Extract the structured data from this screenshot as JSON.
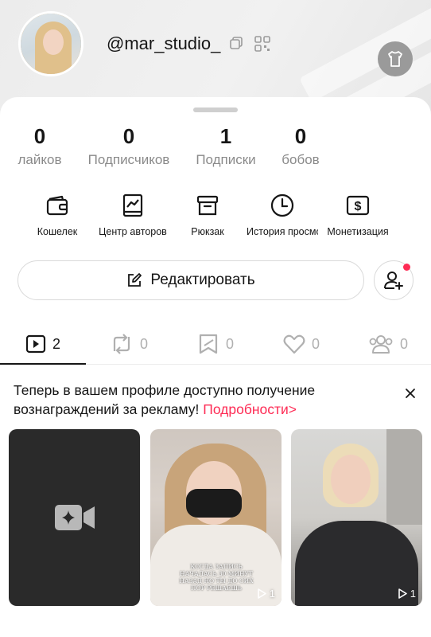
{
  "profile": {
    "username": "@mar_studio_"
  },
  "stats": [
    {
      "value": "0",
      "label": "лайков"
    },
    {
      "value": "0",
      "label": "Подписчиков"
    },
    {
      "value": "1",
      "label": "Подписки"
    },
    {
      "value": "0",
      "label": "бобов"
    }
  ],
  "tools": [
    {
      "label": "Кошелек",
      "icon": "wallet-icon"
    },
    {
      "label": "Центр авторов",
      "icon": "creator-center-icon"
    },
    {
      "label": "Рюкзак",
      "icon": "backpack-icon"
    },
    {
      "label": "История просмотров",
      "icon": "history-icon"
    },
    {
      "label": "Монетизация",
      "icon": "monetization-icon"
    }
  ],
  "edit_button": {
    "label": "Редактировать"
  },
  "tabs": [
    {
      "name": "videos",
      "count": "2",
      "icon": "video-icon"
    },
    {
      "name": "reposts",
      "count": "0",
      "icon": "repost-icon"
    },
    {
      "name": "favorites",
      "count": "0",
      "icon": "bookmark-icon"
    },
    {
      "name": "liked",
      "count": "0",
      "icon": "heart-icon"
    },
    {
      "name": "friends",
      "count": "0",
      "icon": "friends-icon"
    }
  ],
  "banner": {
    "text": "Теперь в вашем профиле доступно получение вознаграждений за рекламу!",
    "link": "Подробности>"
  },
  "videos": [
    {
      "type": "create",
      "icon": "add-video-icon"
    },
    {
      "type": "video",
      "views": "1",
      "caption": "КОГДА ЗАПИСЬ НАЧАЛАСЬ 30 МИНУТ НАЗАД НО ТЫ ДО СИХ ПОР РЕШАЕШЬ"
    },
    {
      "type": "video",
      "views": "1"
    }
  ],
  "colors": {
    "accent": "#fe2c55",
    "text": "#161616",
    "muted": "#8a8a8a"
  }
}
